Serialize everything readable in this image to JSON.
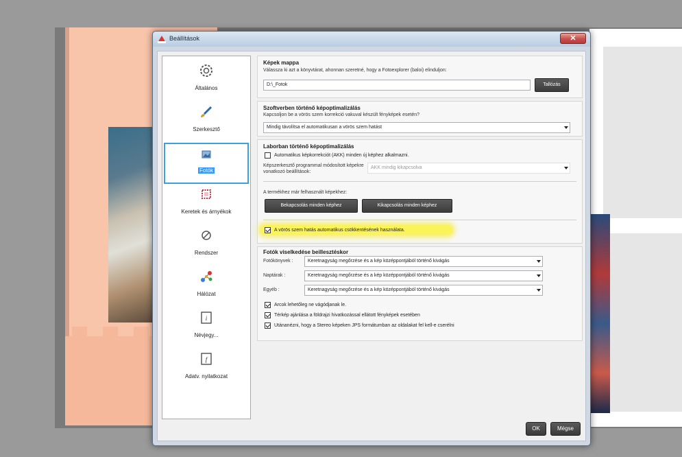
{
  "dialog": {
    "title": "Beállítások",
    "close_symbol": "✕"
  },
  "sidebar": {
    "items": [
      {
        "label": "Általános",
        "icon": "gear-icon"
      },
      {
        "label": "Szerkesztő",
        "icon": "brush-icon"
      },
      {
        "label": "Fotók",
        "icon": "photo-icon",
        "selected": true
      },
      {
        "label": "Keretek és árnyékok",
        "icon": "frame-icon"
      },
      {
        "label": "Rendszer",
        "icon": "system-icon"
      },
      {
        "label": "Hálózat",
        "icon": "network-icon"
      },
      {
        "label": "Névjegy...",
        "icon": "card-icon"
      },
      {
        "label": "Adatv. nyilatkozat",
        "icon": "document-icon"
      }
    ]
  },
  "folder_group": {
    "title": "Képek mappa",
    "description": "Válassza ki azt a könyvtárat, ahonnan szeretné, hogy a Fotoexplorer (baloi) elinduljon:",
    "path_value": "D:\\_Fotok",
    "browse_label": "Tallózás"
  },
  "software_group": {
    "title": "Szoftverben történő képoptimalizálás",
    "question": "Kapcsoljon be a vörös szem korrekció vakuval készült fényképek esetén?",
    "selected": "Mindig távolítsa el automatikusan a vörös szem hatást"
  },
  "lab_group": {
    "title": "Laborban történő képoptimalizálás",
    "auto_correct_label": "Automatikus képkorrekciót (AKK) minden új képhez alkalmazni.",
    "auto_correct_checked": false,
    "editor_label": "Képszerkesztő programmal módosított képekre vonatkozó beállítások:",
    "editor_selected": "AKK mindig kikapcsolva",
    "used_images_label": "A termékhez már felhasznált képekhez:",
    "enable_all_label": "Bekapcsolás minden képhez",
    "disable_all_label": "Kikapcsolás minden képhez",
    "red_eye_label": "A vörös szem hatás automatikus csökkentésének használata.",
    "red_eye_checked": true
  },
  "handling_group": {
    "title": "Fotók viselkedése beillesztéskor",
    "rows": [
      {
        "label": "Fotókönyvek :",
        "value": "Keretnagyság megőrzése és a kép középpontjából történő kivágás"
      },
      {
        "label": "Naptárak :",
        "value": "Keretnagyság megőrzése és a kép középpontjából történő kivágás"
      },
      {
        "label": "Egyéb :",
        "value": "Keretnagyság megőrzése és a kép középpontjából történő kivágás"
      }
    ],
    "checks": [
      {
        "label": "Arcok lehetőleg ne vágódjanak le.",
        "checked": true
      },
      {
        "label": "Térkép ajánlása a földrajzi hivatkozással ellátott fényképek esetében",
        "checked": true
      },
      {
        "label": "Utánanézni, hogy a Stereo képeken JPS formátumban az oldalakat fel kell-e cserélni",
        "checked": true
      }
    ]
  },
  "footer": {
    "ok_label": "OK",
    "cancel_label": "Mégse"
  },
  "colors": {
    "selection_border": "#3aa0e0",
    "highlight": "#fbf35a",
    "button_dark": "#3c3c3c",
    "close_red": "#c75050"
  }
}
